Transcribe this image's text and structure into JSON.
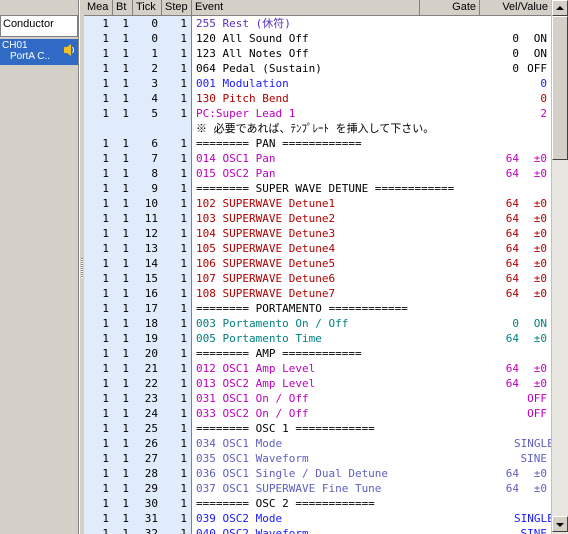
{
  "left_panel": {
    "conductor_label": "Conductor",
    "track": {
      "name": "CH01",
      "sub": "PortA",
      "sub2": "C.."
    }
  },
  "columns": {
    "mea": "Mea",
    "bt": "Bt",
    "tick": "Tick",
    "step": "Step",
    "event": "Event",
    "gate": "Gate",
    "vel": "Vel/Value"
  },
  "rows": [
    {
      "mea": "1",
      "bt": "1",
      "tick": "0",
      "step": "1",
      "event": "255 Rest (休符)",
      "gate": "",
      "vel": "",
      "kind": "rest"
    },
    {
      "mea": "1",
      "bt": "1",
      "tick": "0",
      "step": "1",
      "event": "120 All Sound Off",
      "gate": "0",
      "vel": "ON",
      "kind": "sys"
    },
    {
      "mea": "1",
      "bt": "1",
      "tick": "1",
      "step": "1",
      "event": "123 All Notes Off",
      "gate": "0",
      "vel": "ON",
      "kind": "sys"
    },
    {
      "mea": "1",
      "bt": "1",
      "tick": "2",
      "step": "1",
      "event": "064 Pedal (Sustain)",
      "gate": "0",
      "vel": "OFF",
      "kind": "sys"
    },
    {
      "mea": "1",
      "bt": "1",
      "tick": "3",
      "step": "1",
      "event": "001 Modulation",
      "gate": "",
      "vel": "0",
      "kind": "blue"
    },
    {
      "mea": "1",
      "bt": "1",
      "tick": "4",
      "step": "1",
      "event": "130 Pitch Bend",
      "gate": "",
      "vel": "0",
      "kind": "red"
    },
    {
      "mea": "1",
      "bt": "1",
      "tick": "5",
      "step": "1",
      "event": "PC:Super Lead 1",
      "gate": "",
      "vel": "2",
      "kind": "pink"
    },
    {
      "mea": "",
      "bt": "",
      "tick": "",
      "step": "",
      "event": "※ 必要であれば、ﾃﾝﾌﾟﾚｰﾄ を挿入して下さい。",
      "gate": "",
      "vel": "",
      "kind": "sys"
    },
    {
      "mea": "1",
      "bt": "1",
      "tick": "6",
      "step": "1",
      "event": "======== PAN ============",
      "gate": "",
      "vel": "",
      "kind": "sep"
    },
    {
      "mea": "1",
      "bt": "1",
      "tick": "7",
      "step": "1",
      "event": "014 OSC1 Pan",
      "gate": "64",
      "vel": "±0",
      "kind": "pink"
    },
    {
      "mea": "1",
      "bt": "1",
      "tick": "8",
      "step": "1",
      "event": "015 OSC2 Pan",
      "gate": "64",
      "vel": "±0",
      "kind": "pink"
    },
    {
      "mea": "1",
      "bt": "1",
      "tick": "9",
      "step": "1",
      "event": "======== SUPER WAVE DETUNE ============",
      "gate": "",
      "vel": "",
      "kind": "sep"
    },
    {
      "mea": "1",
      "bt": "1",
      "tick": "10",
      "step": "1",
      "event": "102 SUPERWAVE Detune1",
      "gate": "64",
      "vel": "±0",
      "kind": "red"
    },
    {
      "mea": "1",
      "bt": "1",
      "tick": "11",
      "step": "1",
      "event": "103 SUPERWAVE Detune2",
      "gate": "64",
      "vel": "±0",
      "kind": "red"
    },
    {
      "mea": "1",
      "bt": "1",
      "tick": "12",
      "step": "1",
      "event": "104 SUPERWAVE Detune3",
      "gate": "64",
      "vel": "±0",
      "kind": "red"
    },
    {
      "mea": "1",
      "bt": "1",
      "tick": "13",
      "step": "1",
      "event": "105 SUPERWAVE Detune4",
      "gate": "64",
      "vel": "±0",
      "kind": "red"
    },
    {
      "mea": "1",
      "bt": "1",
      "tick": "14",
      "step": "1",
      "event": "106 SUPERWAVE Detune5",
      "gate": "64",
      "vel": "±0",
      "kind": "red"
    },
    {
      "mea": "1",
      "bt": "1",
      "tick": "15",
      "step": "1",
      "event": "107 SUPERWAVE Detune6",
      "gate": "64",
      "vel": "±0",
      "kind": "red"
    },
    {
      "mea": "1",
      "bt": "1",
      "tick": "16",
      "step": "1",
      "event": "108 SUPERWAVE Detune7",
      "gate": "64",
      "vel": "±0",
      "kind": "red"
    },
    {
      "mea": "1",
      "bt": "1",
      "tick": "17",
      "step": "1",
      "event": "======== PORTAMENTO ============",
      "gate": "",
      "vel": "",
      "kind": "sep"
    },
    {
      "mea": "1",
      "bt": "1",
      "tick": "18",
      "step": "1",
      "event": "003 Portamento On / Off",
      "gate": "0",
      "vel": "ON",
      "kind": "teal"
    },
    {
      "mea": "1",
      "bt": "1",
      "tick": "19",
      "step": "1",
      "event": "005 Portamento Time",
      "gate": "64",
      "vel": "±0",
      "kind": "teal"
    },
    {
      "mea": "1",
      "bt": "1",
      "tick": "20",
      "step": "1",
      "event": "======== AMP ============",
      "gate": "",
      "vel": "",
      "kind": "sep"
    },
    {
      "mea": "1",
      "bt": "1",
      "tick": "21",
      "step": "1",
      "event": "012 OSC1 Amp Level",
      "gate": "64",
      "vel": "±0",
      "kind": "pink"
    },
    {
      "mea": "1",
      "bt": "1",
      "tick": "22",
      "step": "1",
      "event": "013 OSC2 Amp Level",
      "gate": "64",
      "vel": "±0",
      "kind": "pink"
    },
    {
      "mea": "1",
      "bt": "1",
      "tick": "23",
      "step": "1",
      "event": "031 OSC1 On / Off",
      "gate": "",
      "vel": "OFF",
      "kind": "pink"
    },
    {
      "mea": "1",
      "bt": "1",
      "tick": "24",
      "step": "1",
      "event": "033 OSC2 On / Off",
      "gate": "",
      "vel": "OFF",
      "kind": "pink"
    },
    {
      "mea": "1",
      "bt": "1",
      "tick": "25",
      "step": "1",
      "event": "======== OSC 1 ============",
      "gate": "",
      "vel": "",
      "kind": "sep"
    },
    {
      "mea": "1",
      "bt": "1",
      "tick": "26",
      "step": "1",
      "event": "034 OSC1 Mode",
      "gate": "",
      "vel": "SINGLE",
      "kind": "violet"
    },
    {
      "mea": "1",
      "bt": "1",
      "tick": "27",
      "step": "1",
      "event": "035 OSC1 Waveform",
      "gate": "",
      "vel": "SINE",
      "kind": "violet"
    },
    {
      "mea": "1",
      "bt": "1",
      "tick": "28",
      "step": "1",
      "event": "036 OSC1 Single / Dual Detune",
      "gate": "64",
      "vel": "±0",
      "kind": "violet"
    },
    {
      "mea": "1",
      "bt": "1",
      "tick": "29",
      "step": "1",
      "event": "037 OSC1 SUPERWAVE Fine Tune",
      "gate": "64",
      "vel": "±0",
      "kind": "violet"
    },
    {
      "mea": "1",
      "bt": "1",
      "tick": "30",
      "step": "1",
      "event": "======== OSC 2 ============",
      "gate": "",
      "vel": "",
      "kind": "sep"
    },
    {
      "mea": "1",
      "bt": "1",
      "tick": "31",
      "step": "1",
      "event": "039 OSC2 Mode",
      "gate": "",
      "vel": "SINGLE",
      "kind": "blue"
    },
    {
      "mea": "1",
      "bt": "1",
      "tick": "32",
      "step": "1",
      "event": "040 OSC2 Waveform",
      "gate": "",
      "vel": "SINE",
      "kind": "blue"
    }
  ]
}
